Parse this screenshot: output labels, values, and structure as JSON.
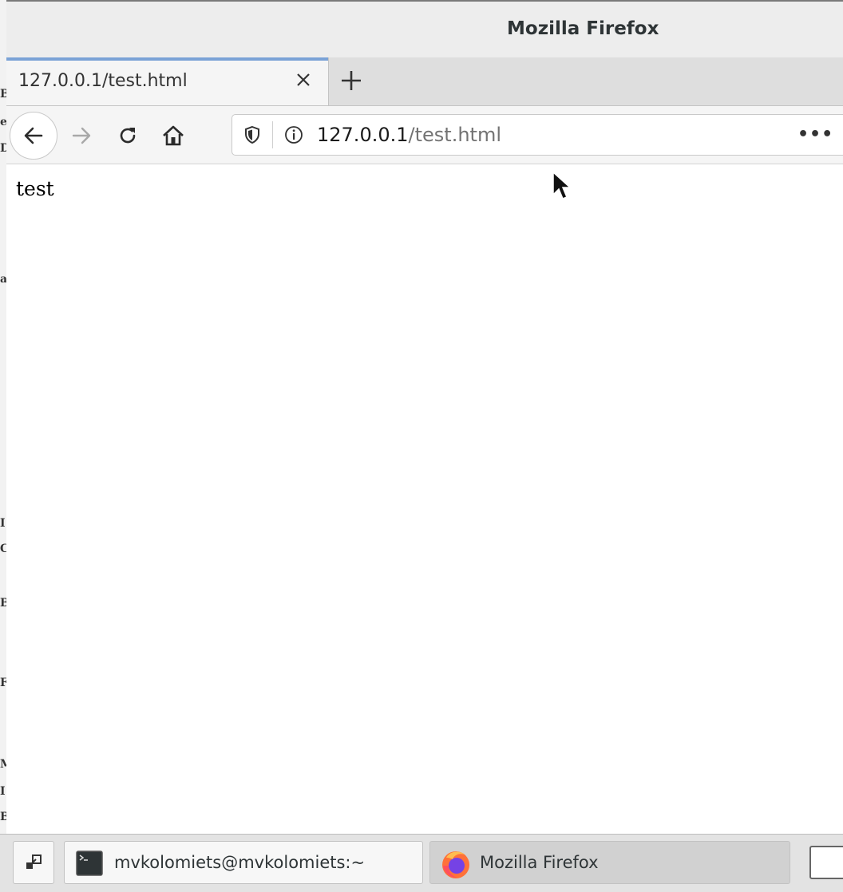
{
  "window": {
    "title": "Mozilla Firefox"
  },
  "tabs": [
    {
      "label": "127.0.0.1/test.html"
    }
  ],
  "urlbar": {
    "host": "127.0.0.1",
    "path": "/test.html"
  },
  "page": {
    "body_text": "test"
  },
  "taskbar": {
    "items": [
      {
        "label": "mvkolomiets@mvkolomiets:~",
        "icon": "terminal-icon"
      },
      {
        "label": "Mozilla Firefox",
        "icon": "firefox-icon",
        "active": true
      }
    ]
  },
  "colors": {
    "tab_accent": "#7aa2d6",
    "url_path": "#737373"
  }
}
